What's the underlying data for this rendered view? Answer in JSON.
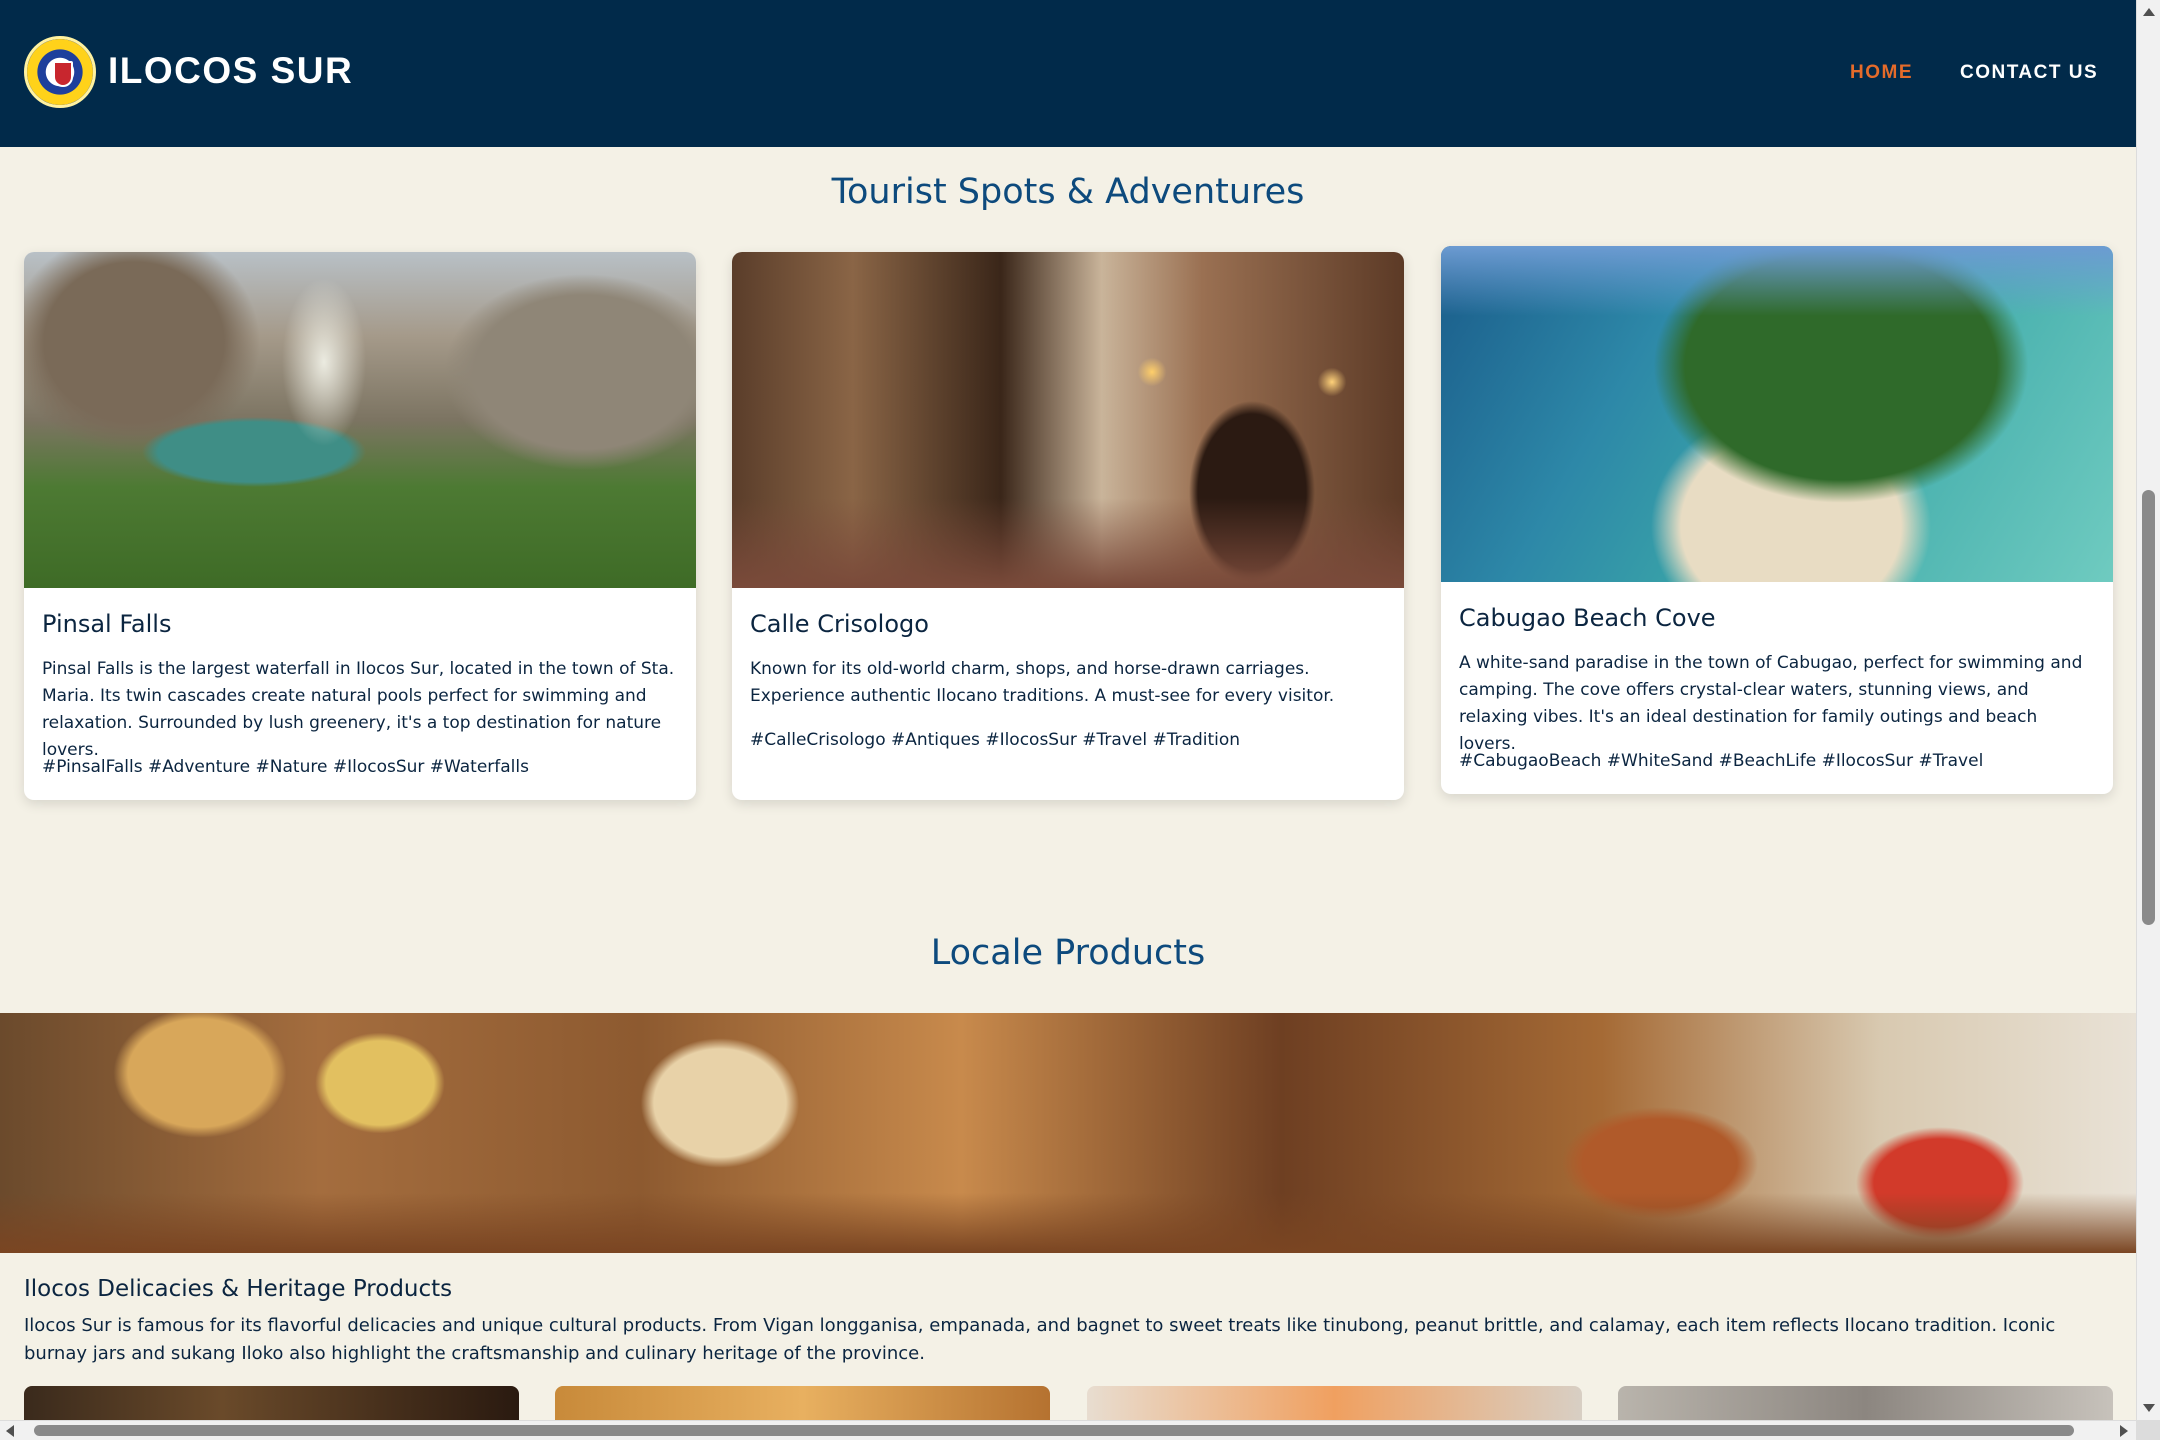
{
  "header": {
    "brand": "ILOCOS SUR",
    "nav": {
      "home": "HOME",
      "contact": "CONTACT US"
    },
    "colors": {
      "background": "#012a4a",
      "active_nav": "#e56b2a"
    }
  },
  "tourist": {
    "title": "Tourist Spots & Adventures",
    "cards": [
      {
        "title": "Pinsal Falls",
        "description": "Pinsal Falls is the largest waterfall in Ilocos Sur, located in the town of Sta. Maria. Its twin cascades create natural pools perfect for swimming and relaxation. Surrounded by lush greenery, it's a top destination for nature lovers.",
        "tags": "#PinsalFalls #Adventure #Nature #IlocosSur #Waterfalls"
      },
      {
        "title": "Calle Crisologo",
        "description": "Known for its old-world charm, shops, and horse-drawn carriages. Experience authentic Ilocano traditions. A must-see for every visitor.",
        "tags": "#CalleCrisologo #Antiques #IlocosSur #Travel #Tradition"
      },
      {
        "title": "Cabugao Beach Cove",
        "description": "A white-sand paradise in the town of Cabugao, perfect for swimming and camping. The cove offers crystal-clear waters, stunning views, and relaxing vibes. It's an ideal destination for family outings and beach lovers.",
        "tags": "#CabugaoBeach #WhiteSand #BeachLife #IlocosSur #Travel"
      }
    ]
  },
  "products": {
    "title": "Locale Products",
    "banner_title": "Ilocos Delicacies & Heritage Products",
    "banner_description": "Ilocos Sur is famous for its flavorful delicacies and unique cultural products. From Vigan longganisa, empanada, and bagnet to sweet treats like tinubong, peanut brittle, and calamay, each item reflects Ilocano tradition. Iconic burnay jars and sukang Iloko also highlight the craftsmanship and culinary heritage of the province."
  }
}
